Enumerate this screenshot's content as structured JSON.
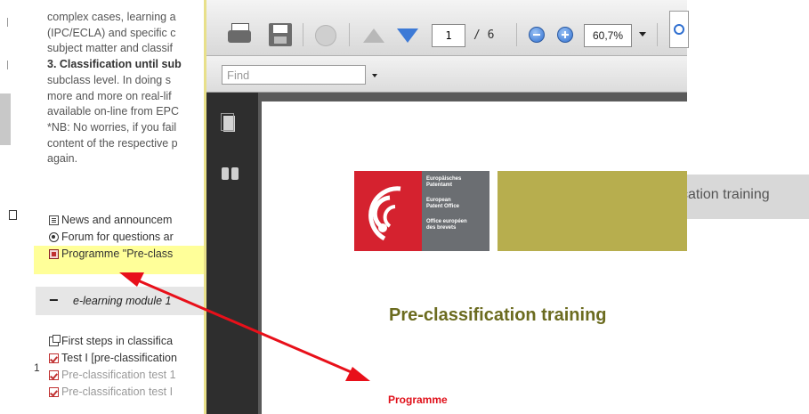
{
  "course": {
    "text_lines": [
      {
        "text": "complex cases, learning a",
        "bold": false
      },
      {
        "text": "(IPC/ECLA) and specific c",
        "bold": false
      },
      {
        "text": "subject matter and classif",
        "bold": false
      },
      {
        "text": "3. Classification until sub",
        "bold": true
      },
      {
        "text": "subclass level. In doing s",
        "bold": false
      },
      {
        "text": "more and more on real-lif",
        "bold": false
      },
      {
        "text": "available on-line from EPC",
        "bold": false
      },
      {
        "text": "*NB: No worries, if you fail",
        "bold": false
      },
      {
        "text": "content of the respective p",
        "bold": false
      },
      {
        "text": "again.",
        "bold": false
      }
    ],
    "resources": [
      {
        "icon": "news-icon",
        "label": "News and announcem"
      },
      {
        "icon": "forum-icon",
        "label": "Forum for questions ar"
      },
      {
        "icon": "pdf-icon",
        "label": "Programme \"Pre-class"
      }
    ],
    "module_title": "e-learning module 1",
    "module_toggle": "−",
    "activities": [
      {
        "icon": "page-icon",
        "label": "First steps in classifica",
        "greyed": false
      },
      {
        "icon": "quiz-icon",
        "label": "Test I [pre-classification",
        "greyed": false
      },
      {
        "icon": "quiz-icon",
        "label": "Pre-classification test 1",
        "greyed": true
      },
      {
        "icon": "quiz-icon",
        "label": "Pre-classification test I",
        "greyed": true
      }
    ],
    "side_number": "1"
  },
  "right_page": {
    "selected_item": "cation training"
  },
  "viewer": {
    "page_current": "1",
    "page_total": "/ 6",
    "zoom": "60,7%",
    "find_placeholder": "Find"
  },
  "document": {
    "logo_lines": [
      "Europäisches",
      "Patentamt",
      "European",
      "Patent Office",
      "Office européen",
      "des brevets"
    ],
    "title": "Pre-classification training",
    "subtitle": "Programme"
  },
  "annotation": {
    "arrow_color": "#e8101a",
    "highlight_color": "#ffff99"
  }
}
